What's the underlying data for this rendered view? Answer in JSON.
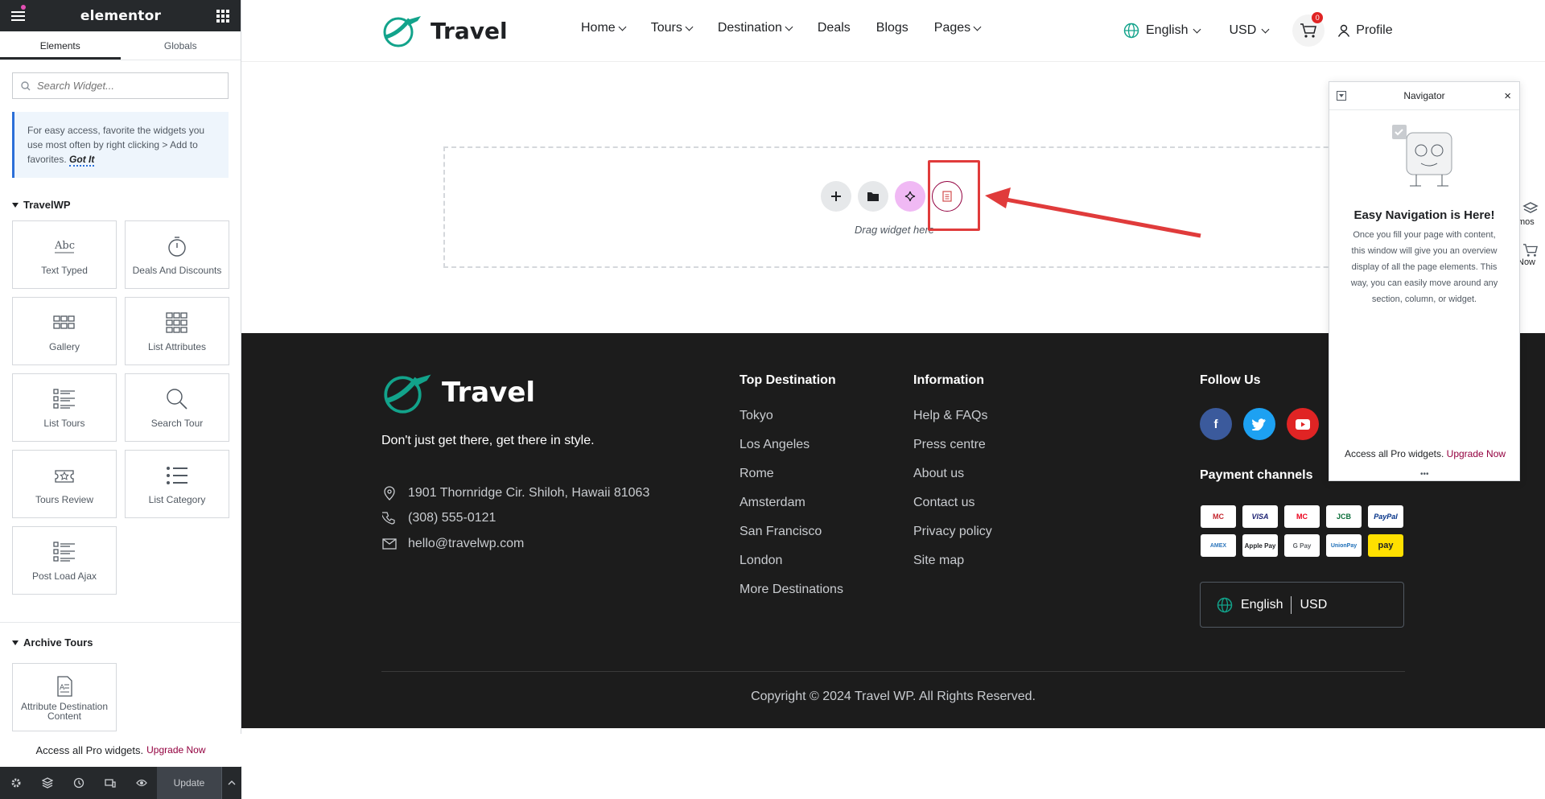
{
  "editor": {
    "brand": "elementor",
    "tabs": [
      "Elements",
      "Globals"
    ],
    "search_placeholder": "Search Widget...",
    "tip_text": "For easy access, favorite the widgets you use most often by right clicking > Add to favorites.",
    "tip_link": "Got It",
    "categories": [
      {
        "name": "TravelWP",
        "widgets": [
          "Text Typed",
          "Deals And Discounts",
          "Gallery",
          "List Attributes",
          "List Tours",
          "Search Tour",
          "Tours Review",
          "List Category",
          "Post Load Ajax"
        ]
      },
      {
        "name": "Archive Tours",
        "widgets": [
          "Attribute Destination Content"
        ]
      }
    ],
    "promo_text": "Access all Pro widgets.",
    "promo_link": "Upgrade Now",
    "update_label": "Update"
  },
  "site": {
    "brand": "Travel",
    "nav": [
      "Home",
      "Tours",
      "Destination",
      "Deals",
      "Blogs",
      "Pages"
    ],
    "language": "English",
    "currency": "USD",
    "cart_count": "0",
    "profile": "Profile",
    "accent": "#12a38b"
  },
  "canvas": {
    "drop_hint": "Drag widget here"
  },
  "footer": {
    "brand": "Travel",
    "tagline": "Don't just get there, get there in style.",
    "address": "1901 Thornridge Cir. Shiloh, Hawaii 81063",
    "phone": "(308) 555-0121",
    "email": "hello@travelwp.com",
    "top_destination_title": "Top Destination",
    "destinations": [
      "Tokyo",
      "Los Angeles",
      "Rome",
      "Amsterdam",
      "San Francisco",
      "London",
      "More Destinations"
    ],
    "information_title": "Information",
    "information": [
      "Help & FAQs",
      "Press centre",
      "About us",
      "Contact us",
      "Privacy policy",
      "Site map"
    ],
    "follow_title": "Follow Us",
    "payment_title": "Payment channels",
    "payments": [
      "MC",
      "VISA",
      "MC",
      "JCB",
      "PayPal",
      "AMEX",
      "Apple Pay",
      "G Pay",
      "UnionPay",
      "pay"
    ],
    "language": "English",
    "currency": "USD",
    "copyright": "Copyright © 2024 Travel WP. All Rights Reserved."
  },
  "navigator": {
    "title": "Navigator",
    "heading": "Easy Navigation is Here!",
    "body": "Once you fill your page with content, this window will give you an overview display of all the page elements. This way, you can easily move around any section, column, or widget.",
    "promo_text": "Access all Pro widgets.",
    "promo_link": "Upgrade Now",
    "edge_a": "mos",
    "edge_b": "Now"
  }
}
